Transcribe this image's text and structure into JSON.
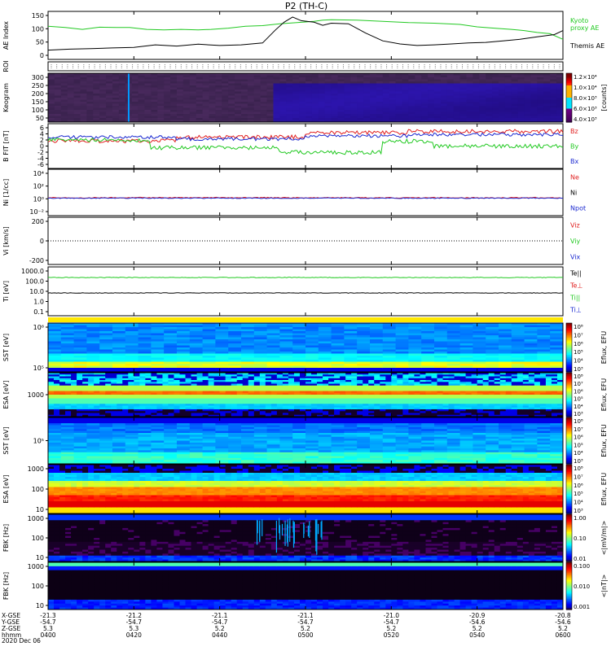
{
  "title": "P2 (TH-C)",
  "colors": {
    "kyoto": "#22c922",
    "themis": "#000000",
    "red": "#e02020",
    "green": "#22c922",
    "blue": "#1a28d0",
    "black": "#000000",
    "yellow": "#ffe800"
  },
  "chart_data": [
    {
      "type": "line",
      "name": "ae",
      "ylabel": "AE Index",
      "ylim": [
        -5,
        150
      ],
      "yticks": [
        "150",
        "100",
        "50",
        "0"
      ],
      "x": [
        "0400",
        "0420",
        "0440",
        "0500",
        "0520",
        "0540",
        "0600"
      ],
      "series": [
        {
          "name": "Kyoto proxy AE",
          "color": "#22c922",
          "values": [
            [
              0,
              102
            ],
            [
              4,
              98
            ],
            [
              8,
              92
            ],
            [
              12,
              99
            ],
            [
              16,
              98
            ],
            [
              19,
              98
            ],
            [
              23,
              92
            ],
            [
              27,
              90
            ],
            [
              31,
              92
            ],
            [
              35,
              90
            ],
            [
              38,
              92
            ],
            [
              42,
              96
            ],
            [
              46,
              102
            ],
            [
              50,
              104
            ],
            [
              54,
              110
            ],
            [
              58,
              114
            ],
            [
              62,
              118
            ],
            [
              64,
              122
            ],
            [
              66,
              123
            ],
            [
              72,
              122
            ],
            [
              78,
              118
            ],
            [
              84,
              114
            ],
            [
              90,
              112
            ],
            [
              96,
              108
            ],
            [
              100,
              100
            ],
            [
              104,
              96
            ],
            [
              108,
              92
            ],
            [
              111,
              88
            ],
            [
              114,
              82
            ],
            [
              117,
              78
            ],
            [
              120,
              60
            ]
          ]
        },
        {
          "name": "Themis AE",
          "color": "#000000",
          "values": [
            [
              0,
              25
            ],
            [
              5,
              28
            ],
            [
              10,
              30
            ],
            [
              15,
              32
            ],
            [
              20,
              34
            ],
            [
              25,
              42
            ],
            [
              30,
              38
            ],
            [
              35,
              44
            ],
            [
              40,
              40
            ],
            [
              45,
              42
            ],
            [
              50,
              48
            ],
            [
              53,
              90
            ],
            [
              55,
              115
            ],
            [
              57,
              132
            ],
            [
              59,
              120
            ],
            [
              62,
              115
            ],
            [
              64,
              105
            ],
            [
              66,
              112
            ],
            [
              70,
              110
            ],
            [
              74,
              80
            ],
            [
              78,
              55
            ],
            [
              82,
              45
            ],
            [
              86,
              40
            ],
            [
              90,
              42
            ],
            [
              94,
              45
            ],
            [
              98,
              48
            ],
            [
              102,
              50
            ],
            [
              106,
              55
            ],
            [
              110,
              60
            ],
            [
              114,
              68
            ],
            [
              118,
              75
            ],
            [
              120,
              88
            ]
          ]
        }
      ]
    },
    {
      "type": "heatmap",
      "name": "roi",
      "ylabel": "ROI"
    },
    {
      "type": "heatmap",
      "name": "keogram",
      "ylabel": "Keogram",
      "yticks": [
        "300",
        "250",
        "200",
        "150",
        "100",
        "50"
      ],
      "colorbar_label": "[counts]",
      "colorbar_ticks": [
        "1.2×10⁴",
        "1.0×10⁴",
        "8.0×10³",
        "6.0×10³",
        "4.0×10³"
      ]
    },
    {
      "type": "line",
      "name": "bfield",
      "ylabel": "B FIT [nT]",
      "ylim": [
        -8,
        6
      ],
      "yticks": [
        "6",
        "4",
        "2",
        "0",
        "-2",
        "-4",
        "-6"
      ],
      "legend": [
        "Bz",
        "By",
        "Bx"
      ]
    },
    {
      "type": "line",
      "name": "density",
      "ylabel": "Ni [1/cc]",
      "yticks": [
        "10⁴",
        "10²",
        "10⁰",
        "10⁻²"
      ],
      "legend": [
        "Ne",
        "Ni",
        "Npot"
      ]
    },
    {
      "type": "line",
      "name": "velocity",
      "ylabel": "Vi [km/s]",
      "yticks": [
        "200",
        "0",
        "-200"
      ],
      "legend": [
        "Viz",
        "Viy",
        "Vix"
      ]
    },
    {
      "type": "line",
      "name": "temperature",
      "ylabel": "Ti [eV]",
      "yticks": [
        "1000.0",
        "100.0",
        "10.0",
        "1.0",
        "0.1"
      ],
      "legend": [
        "Te||",
        "Te⊥",
        "Ti||",
        "Ti⊥"
      ]
    },
    {
      "type": "heatmap",
      "name": "sst_i",
      "ylabel": "SST [eV]",
      "yticks": [
        "10⁶",
        "10⁵"
      ],
      "colorbar_label": "Eflux, EFU",
      "colorbar_ticks": [
        "10⁸",
        "10⁷",
        "10⁶",
        "10⁵",
        "10⁴",
        "10³"
      ]
    },
    {
      "type": "heatmap",
      "name": "esa_i",
      "ylabel": "ESA [eV]",
      "yticks": [
        "1000"
      ],
      "colorbar_label": "Eflux, EFU",
      "colorbar_ticks": [
        "10⁸",
        "10⁷",
        "10⁶",
        "10⁵",
        "10⁴",
        "10³"
      ]
    },
    {
      "type": "heatmap",
      "name": "sst_e",
      "ylabel": "SST [eV]",
      "yticks": [
        "10⁵"
      ],
      "colorbar_label": "Eflux, EFU",
      "colorbar_ticks": [
        "10⁸",
        "10⁷",
        "10⁶",
        "10⁵",
        "10⁴",
        "10³"
      ]
    },
    {
      "type": "heatmap",
      "name": "esa_e",
      "ylabel": "ESA [eV]",
      "yticks": [
        "1000",
        "100",
        "10"
      ],
      "colorbar_label": "Eflux, EFU",
      "colorbar_ticks": [
        "10⁸",
        "10⁷",
        "10⁶",
        "10⁵",
        "10⁴",
        "10³"
      ]
    },
    {
      "type": "heatmap",
      "name": "fbk_e",
      "ylabel": "FBK [Hz]",
      "yticks": [
        "1000",
        "100",
        "10"
      ],
      "colorbar_label": "<|mV/m|>",
      "colorbar_ticks": [
        "1.00",
        "0.10",
        "0.01"
      ]
    },
    {
      "type": "heatmap",
      "name": "fbk_b",
      "ylabel": "FBK [Hz]",
      "yticks": [
        "1000",
        "100",
        "10"
      ],
      "colorbar_label": "<|nT|>",
      "colorbar_ticks": [
        "0.100",
        "0.010",
        "0.001"
      ]
    }
  ],
  "xaxis": {
    "rows": [
      {
        "label": "X-GSE",
        "values": [
          "-21.3",
          "-21.2",
          "-21.1",
          "-21.1",
          "-21.0",
          "-20.9",
          "-20.8"
        ]
      },
      {
        "label": "Y-GSE",
        "values": [
          "-54.7",
          "-54.7",
          "-54.7",
          "-54.7",
          "-54.7",
          "-54.6",
          "-54.6"
        ]
      },
      {
        "label": "Z-GSE",
        "values": [
          "5.3",
          "5.3",
          "5.2",
          "5.2",
          "5.2",
          "5.2",
          "5.2"
        ]
      },
      {
        "label": "hhmm",
        "values": [
          "0400",
          "0420",
          "0440",
          "0500",
          "0520",
          "0540",
          "0600"
        ]
      }
    ],
    "date": "2020 Dec 06"
  }
}
